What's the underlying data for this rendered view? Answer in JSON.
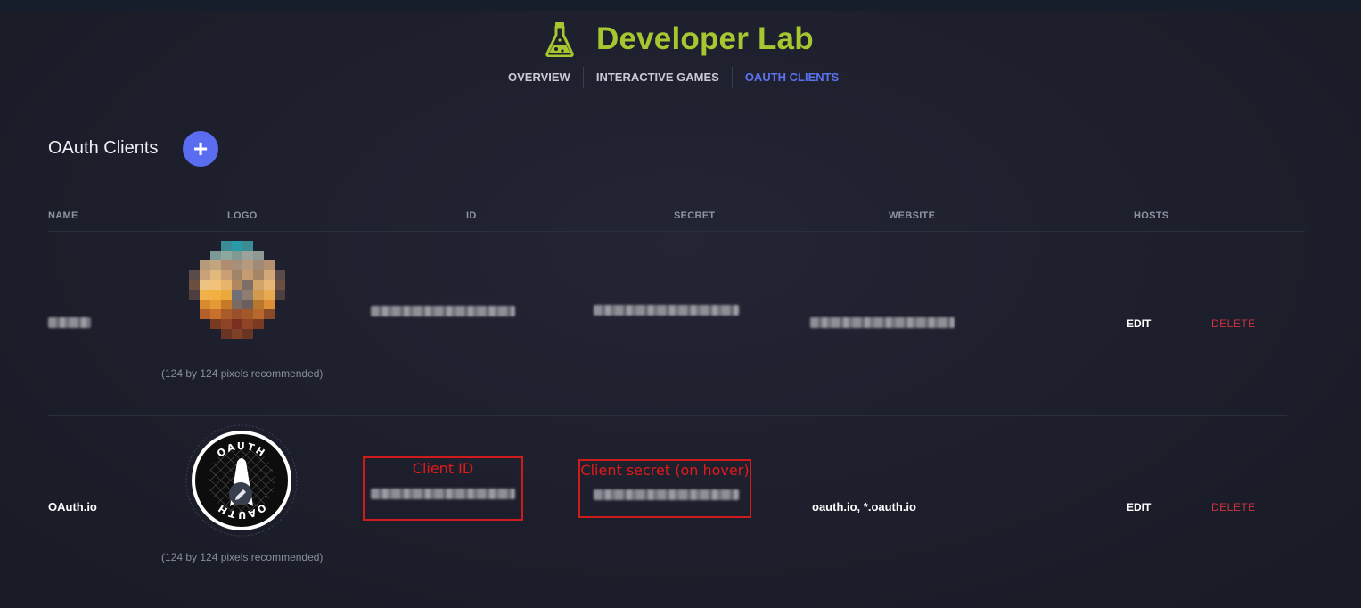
{
  "header": {
    "title": "Developer Lab",
    "icon": "flask-icon",
    "accent_color": "#a8c62f"
  },
  "nav": {
    "items": [
      {
        "label": "OVERVIEW",
        "active": false
      },
      {
        "label": "INTERACTIVE GAMES",
        "active": false
      },
      {
        "label": "OAUTH CLIENTS",
        "active": true
      }
    ],
    "active_color": "#5c72ee"
  },
  "section": {
    "title": "OAuth Clients",
    "add_icon": "plus-icon",
    "add_symbol": "+"
  },
  "table": {
    "columns": [
      "NAME",
      "LOGO",
      "ID",
      "SECRET",
      "WEBSITE",
      "HOSTS"
    ],
    "rows": [
      {
        "name": "",
        "logo_hint": "(124 by 124 pixels recommended)",
        "website": "",
        "edit_label": "EDIT",
        "delete_label": "DELETE"
      },
      {
        "name": "OAuth.io",
        "logo_hint": "(124 by 124 pixels recommended)",
        "logo_text_top": "OAUTH",
        "logo_text_bottom": "OAUTH",
        "website": "oauth.io, *.oauth.io",
        "edit_label": "EDIT",
        "delete_label": "DELETE"
      }
    ]
  },
  "annotations": {
    "client_id_label": "Client ID",
    "client_secret_label": "Client secret (on hover)",
    "color": "#d01b1b"
  },
  "delete_color": "#d0343e"
}
